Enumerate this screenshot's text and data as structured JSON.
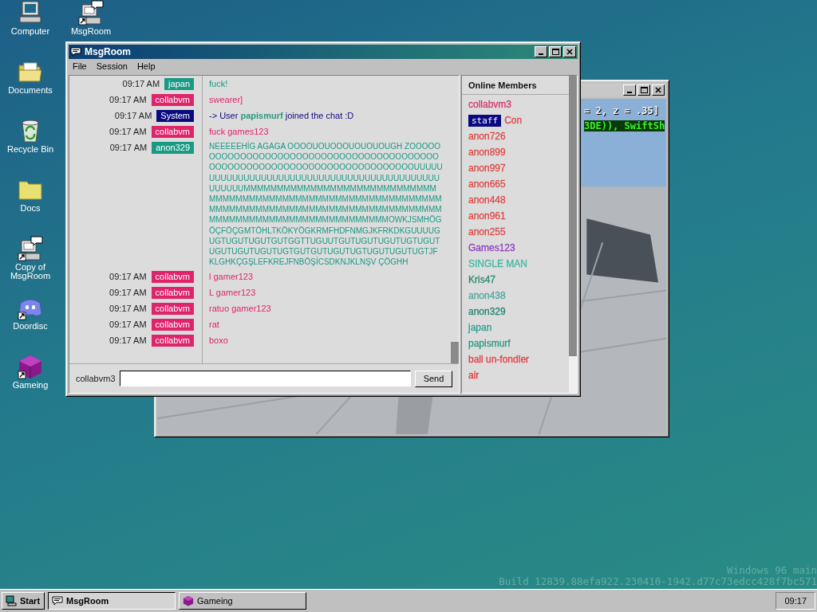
{
  "desktop": {
    "icons": [
      {
        "label": "Computer",
        "kind": "computer",
        "shortcut": false
      },
      {
        "label": "Documents",
        "kind": "folder-open",
        "shortcut": false
      },
      {
        "label": "Recycle Bin",
        "kind": "recycle",
        "shortcut": false
      },
      {
        "label": "Docs",
        "kind": "folder",
        "shortcut": false
      },
      {
        "label": "Copy of MsgRoom",
        "kind": "chat-computer",
        "shortcut": true
      },
      {
        "label": "Doordisc",
        "kind": "blob",
        "shortcut": true
      },
      {
        "label": "Gameing",
        "kind": "cube",
        "shortcut": true
      },
      {
        "label": "MsgRoom",
        "kind": "chat-computer",
        "shortcut": true
      }
    ],
    "build_info": [
      "Windows 96 main",
      "Build 12839.88efa922.230410-1942.d77c73edcc428f7bc571"
    ]
  },
  "game_window": {
    "overlay_lines": [
      {
        "text": "= 2, z = .35]",
        "kind": "plain"
      },
      {
        "text": "3DE)), SwiftSh",
        "kind": "green"
      }
    ]
  },
  "msgroom": {
    "title": "MsgRoom",
    "menu": [
      "File",
      "Session",
      "Help"
    ],
    "messages": [
      {
        "time": "09:17 AM",
        "user": "japan",
        "color": "#1a9a84",
        "text": "fuck!"
      },
      {
        "time": "09:17 AM",
        "user": "collabvm",
        "color": "#e0246c",
        "text": "swearer]"
      },
      {
        "time": "09:17 AM",
        "user": "System",
        "color": "#0a0a80",
        "text": "-> User **papismurf** joined the chat :D"
      },
      {
        "time": "09:17 AM",
        "user": "collabvm",
        "color": "#e0246c",
        "text": "fuck games123"
      },
      {
        "time": "09:17 AM",
        "user": "anon329",
        "color": "#1a9a84",
        "text": "NEEEEEHİG AGAGA OOOOUOUOOOUOUOUOUGH ZOOOOOOOOOOOOOOOOOOOOOOOOOOOOOOOOOOOOOOOOOOOOOOOOOOOOOOOOOOOOOOOOOOOOOOOOOOOUUUUUUUUUUUUUUUUUUUUUUUUUUUUUUUUUUUUUUUUUUUUUUUUUUUMMMMMMMMMMMMMMMMMMMMMMMMMMMMMMMMMMMMMMMMMMMMMMMMMMMMMMMMMMMMMMMMMMMMMMMMMMMMMMMMMMMMMMMMMMMMMMMMMMMMMMMMMMMMMMMMMMMMMMMMMMMMMMOWKJSMHÖGÖÇFÖÇGMTÖHLTKÖKYÖGKRMFHDFNMGJKFRKDKGUUUUGUGTUGUTUGUTGUTGGTTUGUUTGUTUGUTUGUTUGTUGUTUGUTUGUTUGUTUGTGUTGUTUGUTUGTUGUTUGUTUGTJFKLGHKÇGŞLEFKREJFNBÖŞİCSDKNJKLNŞV ÇÖGHH"
      },
      {
        "time": "09:17 AM",
        "user": "collabvm",
        "color": "#e0246c",
        "text": "l gamer123"
      },
      {
        "time": "09:17 AM",
        "user": "collabvm",
        "color": "#e0246c",
        "text": "L gamer123"
      },
      {
        "time": "09:17 AM",
        "user": "collabvm",
        "color": "#e0246c",
        "text": "ratuo gamer123"
      },
      {
        "time": "09:17 AM",
        "user": "collabvm",
        "color": "#e0246c",
        "text": "rat"
      },
      {
        "time": "09:17 AM",
        "user": "collabvm",
        "color": "#e0246c",
        "text": "boxo"
      }
    ],
    "input": {
      "label": "collabvm3",
      "button": "Send"
    },
    "members": {
      "title": "Online Members",
      "items": [
        {
          "name": "collabvm3",
          "color": "#d8346c"
        },
        {
          "badge": "staff",
          "name": "Con",
          "color": "#e04848"
        },
        {
          "name": "anon726",
          "color": "#e04848"
        },
        {
          "name": "anon899",
          "color": "#e04848"
        },
        {
          "name": "anon997",
          "color": "#e04848"
        },
        {
          "name": "anon665",
          "color": "#e04848"
        },
        {
          "name": "anon448",
          "color": "#e04848"
        },
        {
          "name": "anon961",
          "color": "#e04848"
        },
        {
          "name": "anon255",
          "color": "#e04848"
        },
        {
          "name": "Games123",
          "color": "#9040c0"
        },
        {
          "name": "SINGLE MAN",
          "color": "#40b8a0"
        },
        {
          "name": "Kris47",
          "color": "#2a8a70"
        },
        {
          "name": "anon438",
          "color": "#50a8a0"
        },
        {
          "name": "anon329",
          "color": "#208870"
        },
        {
          "name": "japan",
          "color": "#30a090"
        },
        {
          "name": "papismurf",
          "color": "#2a9a80"
        },
        {
          "name": "ball un-fondler",
          "color": "#e04040"
        },
        {
          "name": "air",
          "color": "#e03838"
        }
      ]
    }
  },
  "taskbar": {
    "start": "Start",
    "tasks": [
      {
        "label": "MsgRoom",
        "kind": "chat",
        "selected": true
      },
      {
        "label": "Gameing",
        "kind": "cube",
        "selected": false
      }
    ],
    "clock": "09:17"
  }
}
